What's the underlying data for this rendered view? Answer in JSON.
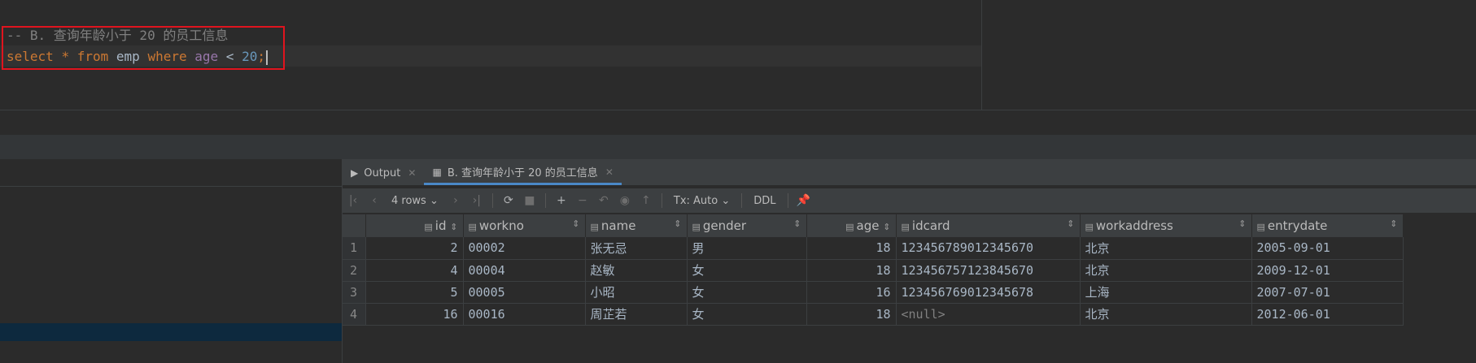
{
  "editor": {
    "comment_line": "-- B. 查询年龄小于 20 的员工信息",
    "sql": {
      "select": "select",
      "star": "*",
      "from": "from",
      "table": "emp",
      "where": "where",
      "column": "age",
      "op": "<",
      "value": "20",
      "semicolon": ";"
    }
  },
  "tabs": [
    {
      "label": "Output",
      "icon": "console-icon"
    },
    {
      "label": "B. 查询年龄小于 20 的员工信息",
      "icon": "table-icon"
    }
  ],
  "toolbar": {
    "rows_label": "4 rows",
    "tx_label": "Tx: Auto",
    "ddl_label": "DDL"
  },
  "grid": {
    "columns": [
      "id",
      "workno",
      "name",
      "gender",
      "age",
      "idcard",
      "workaddress",
      "entrydate"
    ],
    "rows": [
      {
        "rn": "1",
        "id": "2",
        "workno": "00002",
        "name": "张无忌",
        "gender": "男",
        "age": "18",
        "idcard": "123456789012345670",
        "workaddress": "北京",
        "entrydate": "2005-09-01"
      },
      {
        "rn": "2",
        "id": "4",
        "workno": "00004",
        "name": "赵敏",
        "gender": "女",
        "age": "18",
        "idcard": "123456757123845670",
        "workaddress": "北京",
        "entrydate": "2009-12-01"
      },
      {
        "rn": "3",
        "id": "5",
        "workno": "00005",
        "name": "小昭",
        "gender": "女",
        "age": "16",
        "idcard": "123456769012345678",
        "workaddress": "上海",
        "entrydate": "2007-07-01"
      },
      {
        "rn": "4",
        "id": "16",
        "workno": "00016",
        "name": "周芷若",
        "gender": "女",
        "age": "18",
        "idcard": "<null>",
        "workaddress": "北京",
        "entrydate": "2012-06-01"
      }
    ]
  },
  "colors": {
    "accent": "#4a88c7",
    "highlight_box": "#e0141e",
    "keyword": "#cc7832",
    "number": "#6897bb"
  }
}
